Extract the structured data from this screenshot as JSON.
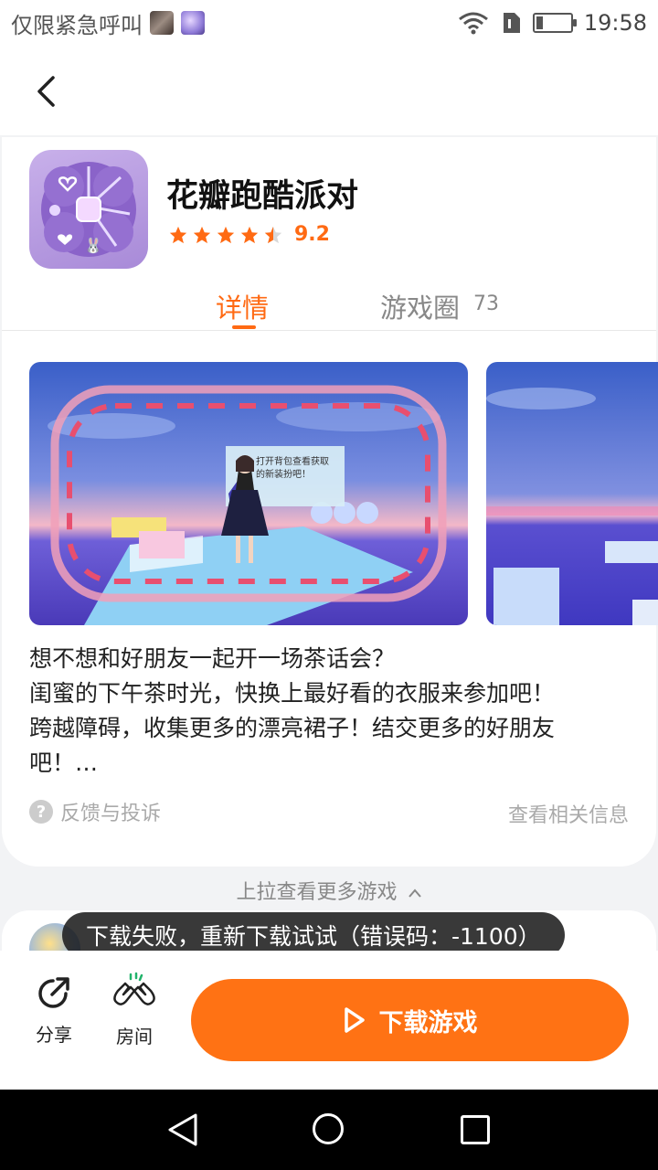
{
  "status_bar": {
    "emergency_text": "仅限紧急呼叫",
    "time": "19:58",
    "battery_level": 0.2
  },
  "app": {
    "name": "花瓣跑酷派对",
    "rating": "9.2",
    "stars": 4.5
  },
  "tabs": {
    "detail": "详情",
    "circle": "游戏圈",
    "circle_count": "73"
  },
  "screenshot": {
    "sign_line1": "打开背包查看获取",
    "sign_line2": "的新装扮吧！"
  },
  "description": {
    "line1": "想不想和好朋友一起开一场茶话会？",
    "line2": "闺蜜的下午茶时光，快换上最好看的衣服来参加吧！",
    "line3": "跨越障碍，收集更多的漂亮裙子！结交更多的好朋友",
    "line4": "吧！…"
  },
  "links": {
    "feedback": "反馈与投诉",
    "related": "查看相关信息"
  },
  "pull_more": "上拉查看更多游戏",
  "toast": "下载失败，重新下载试试（错误码：-1100）",
  "bottom": {
    "share": "分享",
    "room": "房间",
    "download": "下载游戏"
  },
  "colors": {
    "accent": "#ff6a13",
    "download_button": "#ff7214"
  },
  "icons": {
    "back": "chevron-left-icon",
    "share": "share-icon",
    "room": "clapping-hands-icon",
    "play": "play-icon",
    "wifi": "wifi-icon",
    "sim": "sim-card-icon",
    "battery": "battery-icon"
  }
}
